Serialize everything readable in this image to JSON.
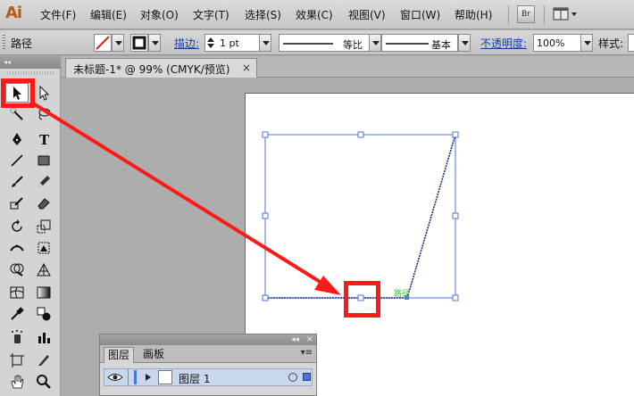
{
  "app": {
    "logo": "Ai"
  },
  "menu": {
    "items": [
      "文件(F)",
      "编辑(E)",
      "对象(O)",
      "文字(T)",
      "选择(S)",
      "效果(C)",
      "视图(V)",
      "窗口(W)",
      "帮助(H)"
    ],
    "bridge_label": "Br"
  },
  "control_bar": {
    "selection_label": "路径",
    "stroke_label": "描边:",
    "stroke_weight": "1 pt",
    "profile_label": "等比",
    "brush_label": "基本",
    "opacity_label": "不透明度:",
    "opacity_value": "100%",
    "style_label": "样式:"
  },
  "document": {
    "tab_title": "未标题-1* @ 99% (CMYK/预览)",
    "close_glyph": "×"
  },
  "artwork": {
    "smart_guide_label": "路径"
  },
  "tools": [
    "selection-tool",
    "direct-selection-tool",
    "magic-wand-tool",
    "lasso-tool",
    "pen-tool",
    "type-tool",
    "line-segment-tool",
    "rectangle-tool",
    "paintbrush-tool",
    "pencil-tool",
    "blob-brush-tool",
    "eraser-tool",
    "rotate-tool",
    "scale-tool",
    "width-tool",
    "free-transform-tool",
    "shape-builder-tool",
    "perspective-grid-tool",
    "mesh-tool",
    "gradient-tool",
    "eyedropper-tool",
    "blend-tool",
    "symbol-sprayer-tool",
    "column-graph-tool",
    "artboard-tool",
    "slice-tool",
    "hand-tool",
    "zoom-tool"
  ],
  "layers_panel": {
    "tab_layers": "图层",
    "tab_artboards": "画板",
    "collapse_glyph": "◂◂",
    "close_glyph": "✕",
    "menu_glyph": "▾≡",
    "layer_name": "图层 1"
  },
  "colors": {
    "annotation_red": "#ff1a1a",
    "selection_blue": "#4a76d8",
    "smart_guide_green": "#3fc43f",
    "app_orange": "#b55a1b"
  }
}
